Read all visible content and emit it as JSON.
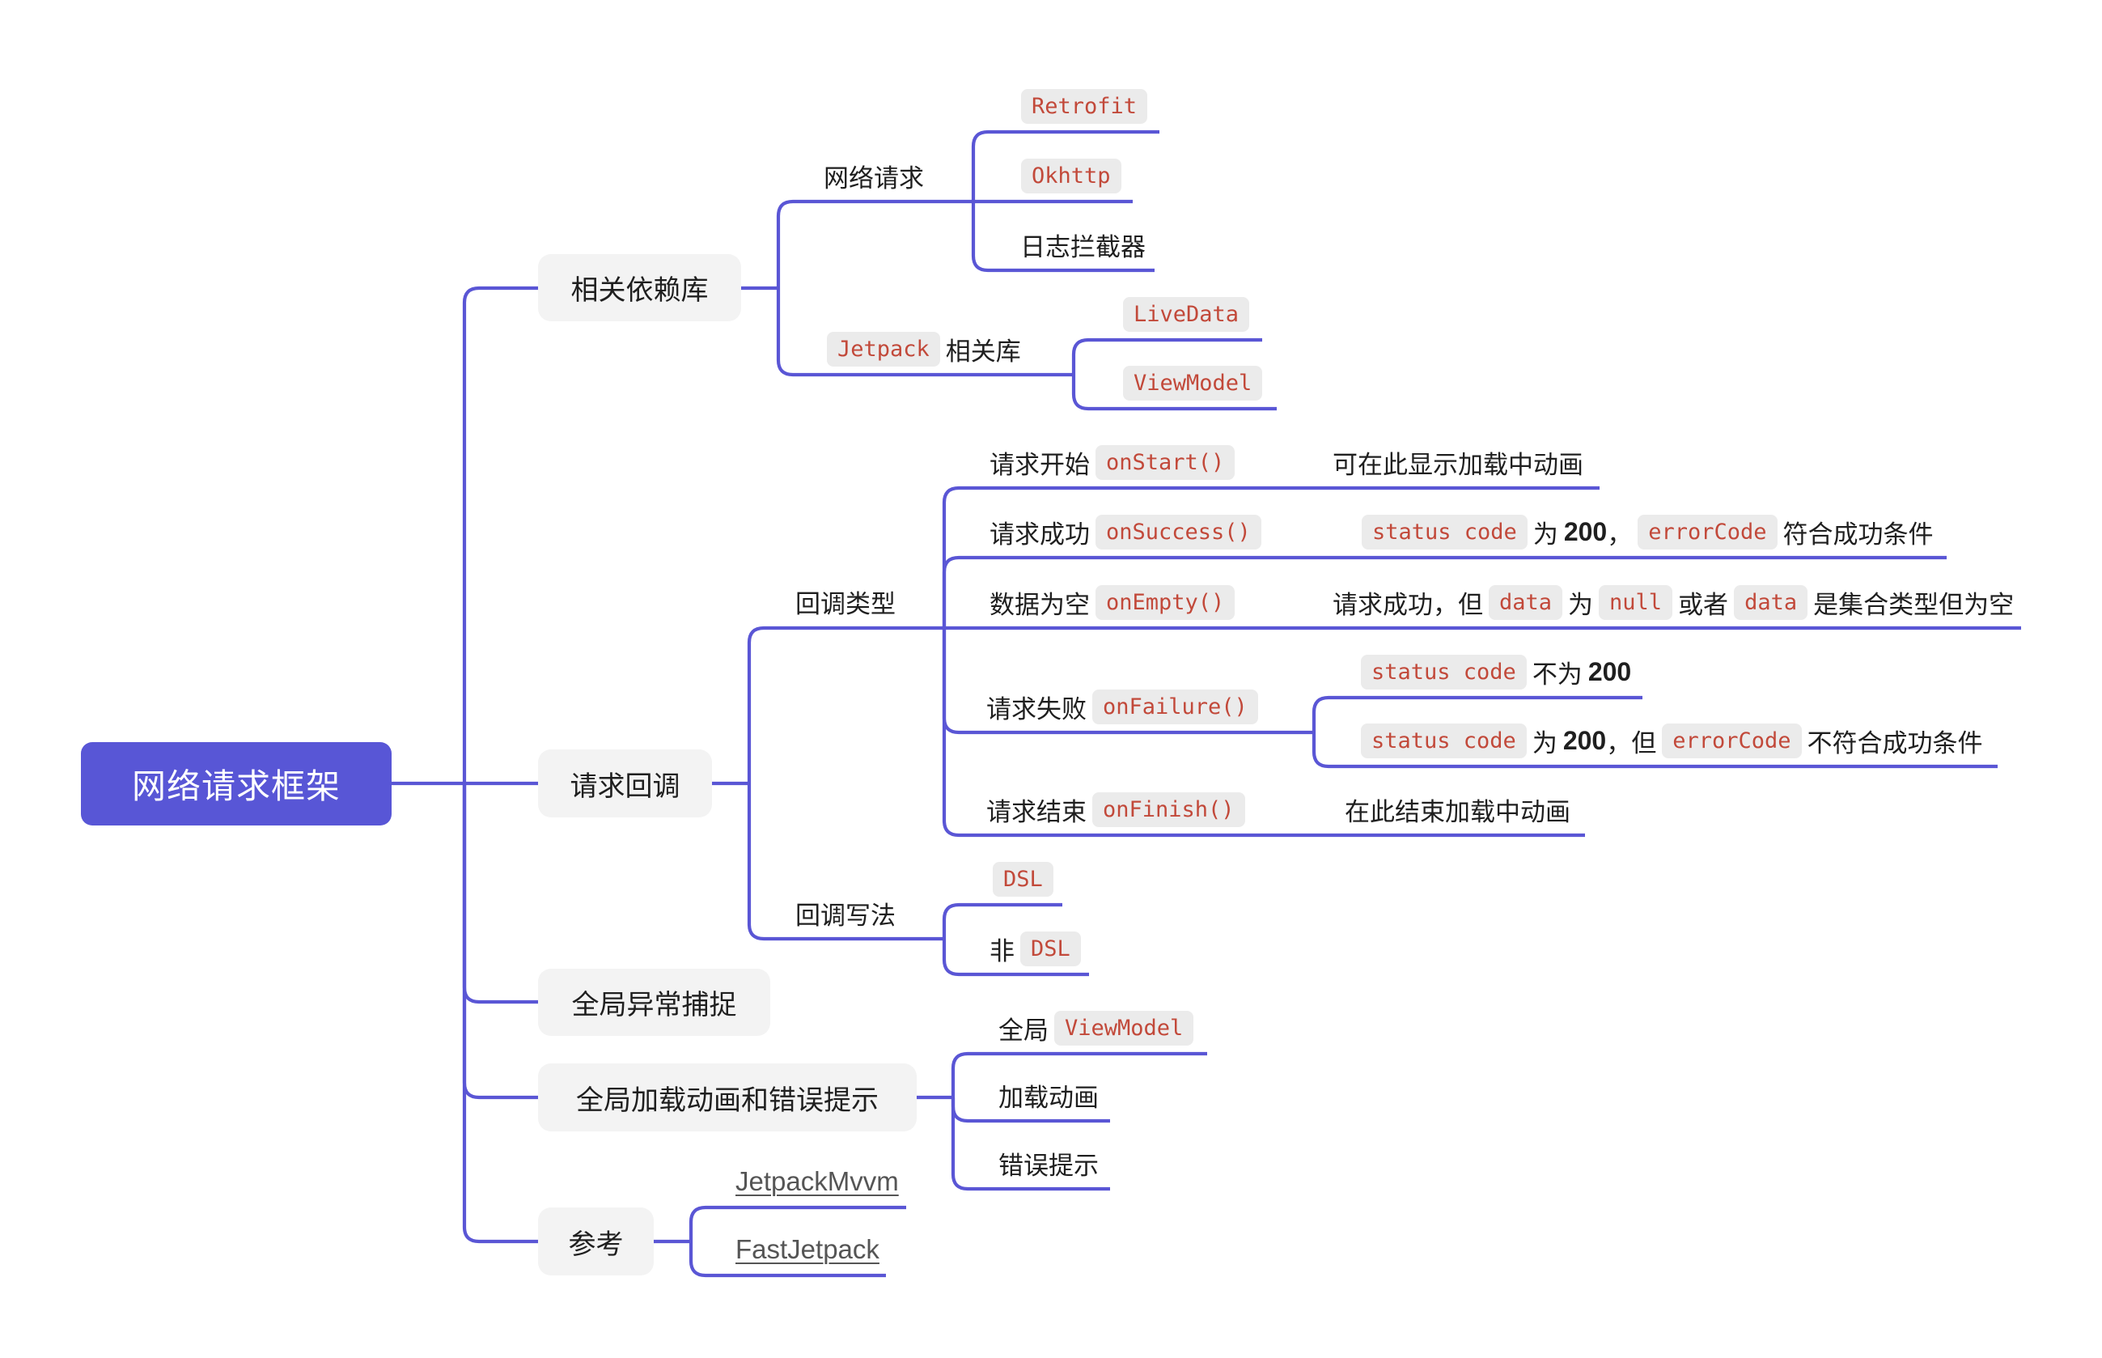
{
  "theme": {
    "accent": "#5a56d5",
    "root_bg": "#5856d6",
    "node_bg": "#f3f3f3",
    "code_bg": "#ebebeb",
    "code_text": "#c2493a",
    "text": "#1f1f1f",
    "link": "#555555"
  },
  "root": {
    "label": "网络请求框架"
  },
  "branches": [
    {
      "label": "相关依赖库",
      "children": [
        {
          "parts": [
            {
              "type": "text",
              "text": "网络请求"
            }
          ],
          "children": [
            {
              "parts": [
                {
                  "type": "code",
                  "text": "Retrofit"
                }
              ]
            },
            {
              "parts": [
                {
                  "type": "code",
                  "text": "Okhttp"
                }
              ]
            },
            {
              "parts": [
                {
                  "type": "text",
                  "text": "日志拦截器"
                }
              ]
            }
          ]
        },
        {
          "parts": [
            {
              "type": "code",
              "text": "Jetpack"
            },
            {
              "type": "text",
              "text": "相关库"
            }
          ],
          "children": [
            {
              "parts": [
                {
                  "type": "code",
                  "text": "LiveData"
                }
              ]
            },
            {
              "parts": [
                {
                  "type": "code",
                  "text": "ViewModel"
                }
              ]
            }
          ]
        }
      ]
    },
    {
      "label": "请求回调",
      "children": [
        {
          "parts": [
            {
              "type": "text",
              "text": "回调类型"
            }
          ],
          "children": [
            {
              "parts": [
                {
                  "type": "text",
                  "text": "请求开始"
                },
                {
                  "type": "code",
                  "text": "onStart()"
                }
              ],
              "children": [
                {
                  "parts": [
                    {
                      "type": "text",
                      "text": "可在此显示加载中动画"
                    }
                  ]
                }
              ]
            },
            {
              "parts": [
                {
                  "type": "text",
                  "text": "请求成功"
                },
                {
                  "type": "code",
                  "text": "onSuccess()"
                }
              ],
              "children": [
                {
                  "parts": [
                    {
                      "type": "code",
                      "text": "status code"
                    },
                    {
                      "type": "text",
                      "text": "为"
                    },
                    {
                      "type": "bold",
                      "text": "200"
                    },
                    {
                      "type": "text",
                      "text": "，"
                    },
                    {
                      "type": "code",
                      "text": "errorCode"
                    },
                    {
                      "type": "text",
                      "text": "符合成功条件"
                    }
                  ]
                }
              ]
            },
            {
              "parts": [
                {
                  "type": "text",
                  "text": "数据为空"
                },
                {
                  "type": "code",
                  "text": "onEmpty()"
                }
              ],
              "children": [
                {
                  "parts": [
                    {
                      "type": "text",
                      "text": "请求成功，但"
                    },
                    {
                      "type": "code",
                      "text": "data"
                    },
                    {
                      "type": "text",
                      "text": "为"
                    },
                    {
                      "type": "code",
                      "text": "null"
                    },
                    {
                      "type": "text",
                      "text": "或者"
                    },
                    {
                      "type": "code",
                      "text": "data"
                    },
                    {
                      "type": "text",
                      "text": "是集合类型但为空"
                    }
                  ]
                }
              ]
            },
            {
              "parts": [
                {
                  "type": "text",
                  "text": "请求失败"
                },
                {
                  "type": "code",
                  "text": "onFailure()"
                }
              ],
              "children": [
                {
                  "parts": [
                    {
                      "type": "code",
                      "text": "status code"
                    },
                    {
                      "type": "text",
                      "text": "不为"
                    },
                    {
                      "type": "bold",
                      "text": "200"
                    }
                  ]
                },
                {
                  "parts": [
                    {
                      "type": "code",
                      "text": "status code"
                    },
                    {
                      "type": "text",
                      "text": "为"
                    },
                    {
                      "type": "bold",
                      "text": "200"
                    },
                    {
                      "type": "text",
                      "text": "，但"
                    },
                    {
                      "type": "code",
                      "text": "errorCode"
                    },
                    {
                      "type": "text",
                      "text": "不符合成功条件"
                    }
                  ]
                }
              ]
            },
            {
              "parts": [
                {
                  "type": "text",
                  "text": "请求结束"
                },
                {
                  "type": "code",
                  "text": "onFinish()"
                }
              ],
              "children": [
                {
                  "parts": [
                    {
                      "type": "text",
                      "text": "在此结束加载中动画"
                    }
                  ]
                }
              ]
            }
          ]
        },
        {
          "parts": [
            {
              "type": "text",
              "text": "回调写法"
            }
          ],
          "children": [
            {
              "parts": [
                {
                  "type": "code",
                  "text": "DSL"
                }
              ]
            },
            {
              "parts": [
                {
                  "type": "text",
                  "text": "非"
                },
                {
                  "type": "code",
                  "text": "DSL"
                }
              ]
            }
          ]
        }
      ]
    },
    {
      "label": "全局异常捕捉"
    },
    {
      "label": "全局加载动画和错误提示",
      "children": [
        {
          "parts": [
            {
              "type": "text",
              "text": "全局"
            },
            {
              "type": "code",
              "text": "ViewModel"
            }
          ]
        },
        {
          "parts": [
            {
              "type": "text",
              "text": "加载动画"
            }
          ]
        },
        {
          "parts": [
            {
              "type": "text",
              "text": "错误提示"
            }
          ]
        }
      ]
    },
    {
      "label": "参考",
      "children": [
        {
          "parts": [
            {
              "type": "link",
              "text": "JetpackMvvm"
            }
          ]
        },
        {
          "parts": [
            {
              "type": "link",
              "text": "FastJetpack"
            }
          ]
        }
      ]
    }
  ]
}
